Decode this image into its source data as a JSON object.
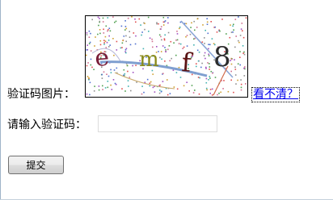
{
  "captcha": {
    "label": "验证码图片：",
    "image_characters": [
      "e",
      "m",
      "f",
      "8"
    ],
    "character_colors": [
      "#7a1f3a",
      "#8a8a1a",
      "#5a1414",
      "#2c2c2c"
    ],
    "refresh_link": "看不清？"
  },
  "form": {
    "input_label": "请输入验证码：",
    "input_value": "",
    "input_placeholder": ""
  },
  "actions": {
    "submit_label": "提交"
  },
  "colors": {
    "link": "#0000ee",
    "captcha_line": "#7f9fd0"
  }
}
